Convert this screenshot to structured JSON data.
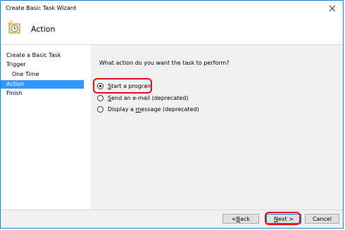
{
  "window": {
    "title": "Create Basic Task Wizard"
  },
  "header": {
    "title": "Action"
  },
  "sidebar": {
    "items": [
      {
        "label": "Create a Basic Task"
      },
      {
        "label": "Trigger"
      },
      {
        "label": "One Time"
      },
      {
        "label": "Action"
      },
      {
        "label": "Finish"
      }
    ]
  },
  "main": {
    "question": "What action do you want the task to perform?",
    "options": [
      {
        "prefix": "",
        "accel": "S",
        "rest": "tart a program",
        "selected": true
      },
      {
        "prefix": "",
        "accel": "S",
        "rest": "end an e-mail (deprecated)",
        "selected": false
      },
      {
        "prefix": "Display a ",
        "accel": "m",
        "rest": "essage (deprecated)",
        "selected": false
      }
    ]
  },
  "footer": {
    "back_prefix": "< ",
    "back_accel": "B",
    "back_rest": "ack",
    "next_accel": "N",
    "next_rest": "ext >",
    "cancel_label": "Cancel"
  },
  "colors": {
    "accent": "#3399ff",
    "highlight": "#e0101f"
  }
}
